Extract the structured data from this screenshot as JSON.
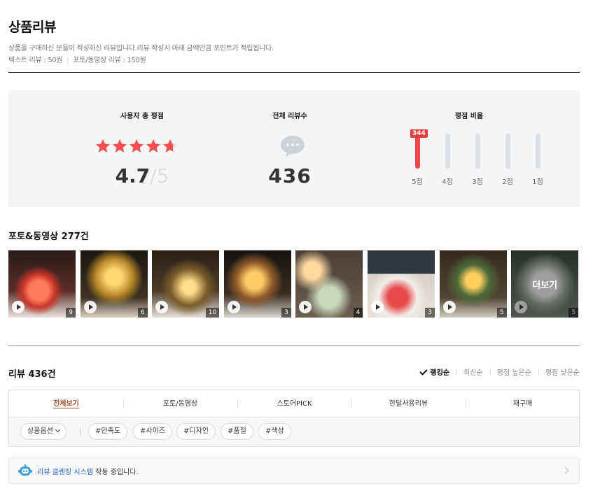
{
  "header": {
    "title": "상품리뷰",
    "description": "상품을 구매하신 분들이 작성하신 리뷰입니다.리뷰 작성시 아래 금액만큼 포인트가 적립됩니다.",
    "text_review_point": "텍스트 리뷰 : 50원",
    "photo_review_point": "포토/동영상 리뷰 : 150원"
  },
  "summary": {
    "avg_label": "사용자 총 평점",
    "avg_score": "4.7",
    "avg_max": "5",
    "star_fraction": 0.94,
    "total_label": "전체 리뷰수",
    "total_count": "436",
    "ratio_label": "평점 비율",
    "ratio_bars": [
      {
        "label": "5점",
        "fraction": 1.0,
        "badge": "344"
      },
      {
        "label": "4점",
        "fraction": 0.0,
        "badge": ""
      },
      {
        "label": "3점",
        "fraction": 0.0,
        "badge": ""
      },
      {
        "label": "2점",
        "fraction": 0.0,
        "badge": ""
      },
      {
        "label": "1점",
        "fraction": 0.0,
        "badge": ""
      }
    ]
  },
  "media": {
    "title": "포토&동영상 277건",
    "more_label": "더보기",
    "thumbs": [
      {
        "count": "9"
      },
      {
        "count": "6"
      },
      {
        "count": "10"
      },
      {
        "count": "3"
      },
      {
        "count": "4"
      },
      {
        "count": "3"
      },
      {
        "count": "5"
      },
      {
        "count": "5"
      }
    ]
  },
  "reviews": {
    "title": "리뷰 436건",
    "sorts": [
      "랭킹순",
      "최신순",
      "평점 높은순",
      "평점 낮은순"
    ],
    "tabs": [
      "전체보기",
      "포토/동영상",
      "스토어PICK",
      "한달사용리뷰",
      "재구매"
    ],
    "option_chip": "상품옵션",
    "filters": [
      "#만족도",
      "#사이즈",
      "#디자인",
      "#품질",
      "#색상"
    ]
  },
  "notice": {
    "highlight": "리뷰 클렌징 시스템",
    "rest": " 작동 중입니다."
  },
  "colors": {
    "star": "#f05050",
    "accent": "#e73c3c",
    "link": "#2a63c9"
  }
}
